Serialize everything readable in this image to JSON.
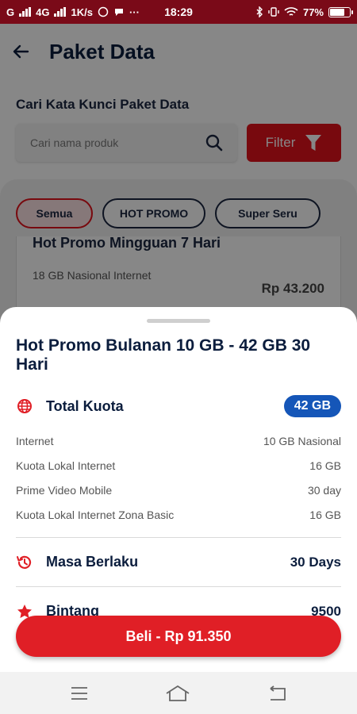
{
  "status_bar": {
    "carrier_left": "G",
    "network": "4G",
    "speed": "1K/s",
    "time": "18:29",
    "battery": "77%"
  },
  "app_bar": {
    "title": "Paket Data"
  },
  "search": {
    "label": "Cari Kata Kunci Paket Data",
    "placeholder": "Cari nama produk",
    "filter_label": "Filter"
  },
  "chips": [
    "Semua",
    "HOT PROMO",
    "Super Seru"
  ],
  "background_card": {
    "name": "Hot Promo Mingguan 7 Hari",
    "desc": "18 GB Nasional Internet",
    "price": "Rp 43.200"
  },
  "sheet": {
    "title": "Hot Promo Bulanan 10 GB - 42 GB 30 Hari",
    "total_label": "Total Kuota",
    "total_value": "42 GB",
    "details": [
      {
        "label": "Internet",
        "value": "10 GB Nasional"
      },
      {
        "label": "Kuota Lokal Internet",
        "value": "16 GB"
      },
      {
        "label": "Prime Video Mobile",
        "value": "30 day"
      },
      {
        "label": "Kuota Lokal Internet Zona Basic",
        "value": "16 GB"
      }
    ],
    "validity_label": "Masa Berlaku",
    "validity_value": "30 Days",
    "star_label": "Bintang",
    "star_value": "9500",
    "buy_label": "Beli - Rp 91.350"
  },
  "colors": {
    "status_bar": "#7a0a18",
    "primary_red": "#e01f26",
    "navy": "#0b1d3d",
    "badge_blue": "#1556b8"
  },
  "icons": [
    "back-arrow-icon",
    "search-icon",
    "filter-funnel-icon",
    "globe-icon",
    "history-icon",
    "star-icon",
    "menu-icon",
    "home-icon",
    "back-nav-icon"
  ]
}
